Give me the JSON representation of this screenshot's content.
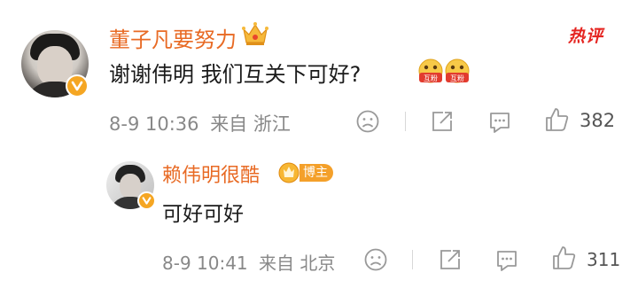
{
  "main_comment": {
    "username": "董子凡要努力",
    "hot_label": "热评",
    "text": "谢谢伟明 我们互关下可好?",
    "emoji_label": "互粉",
    "timestamp": "8-9 10:36",
    "location": "来自 浙江",
    "likes": "382"
  },
  "reply": {
    "username": "赖伟明很酷",
    "badge": "博主",
    "text": "可好可好",
    "timestamp": "8-9 10:41",
    "location": "来自 北京",
    "likes": "311"
  },
  "colors": {
    "username": "#e86a24",
    "hot": "#e52521",
    "verify": "#f5a623",
    "meta": "#888888"
  }
}
